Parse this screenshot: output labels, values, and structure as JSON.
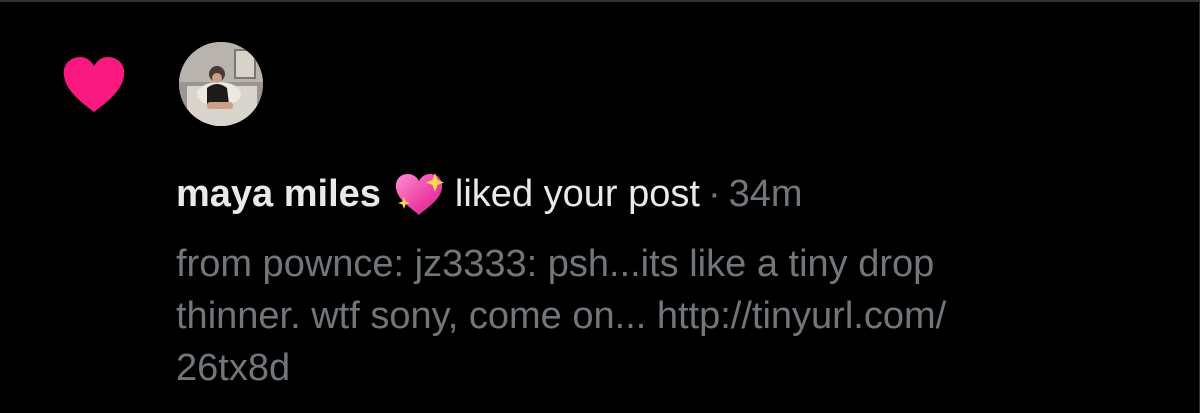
{
  "notification": {
    "type_icon": "heart-icon",
    "user_name": "maya miles",
    "user_emoji": "sparkling-heart-icon",
    "action": "liked your post",
    "separator": "·",
    "time": "34m",
    "post_preview": "from pownce: jz3333: psh...its like a tiny drop\nthinner. wtf sony, come on... http://tinyurl.com/\n26tx8d"
  },
  "colors": {
    "background": "#000000",
    "heart": "#f91880",
    "primary_text": "#e7e9ea",
    "secondary_text": "#71767b"
  }
}
